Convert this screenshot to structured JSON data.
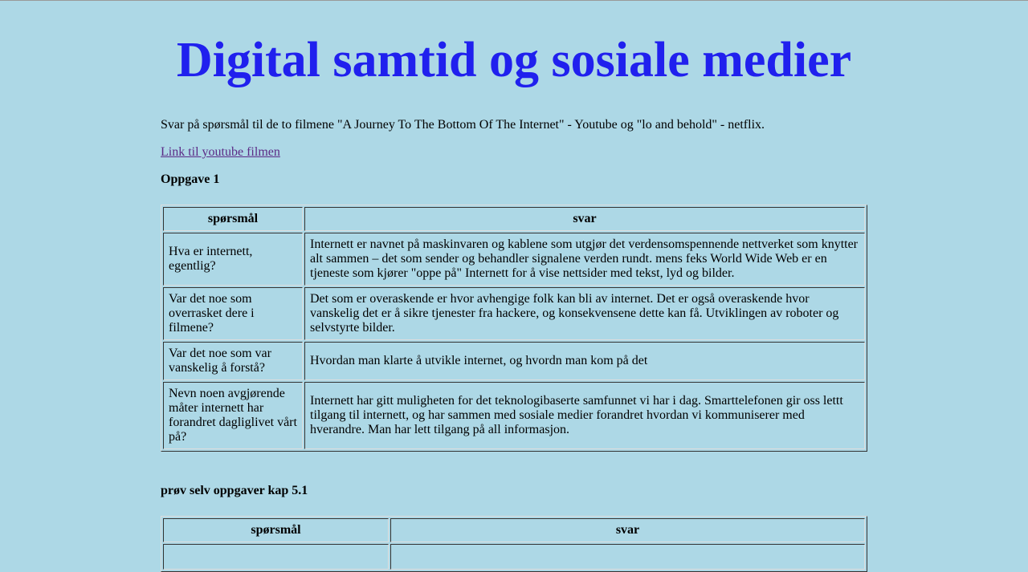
{
  "title": "Digital samtid og sosiale medier",
  "intro": "Svar på spørsmål til de to filmene \"A Journey To The Bottom Of The Internet\" - Youtube og \"lo and behold\" - netflix.",
  "link_label": "Link til youtube filmen",
  "section1": {
    "heading": "Oppgave 1",
    "headers": [
      "spørsmål",
      "svar"
    ],
    "rows": [
      {
        "q": "Hva er internett, egentlig?",
        "a": "Internett er navnet på maskinvaren og kablene som utgjør det verdensomspennende nettverket som knytter alt sammen – det som sender og behandler signalene verden rundt.  mens feks World Wide Web er en tjeneste som kjører \"oppe på\" Internett for å vise nettsider med tekst, lyd og bilder."
      },
      {
        "q": "Var det noe som overrasket dere i filmene?",
        "a": "Det som er overaskende er hvor avhengige folk kan bli av internet. Det er også overaskende hvor vanskelig det er å sikre tjenester fra hackere, og konsekvensene dette kan få. Utviklingen av roboter og selvstyrte bilder."
      },
      {
        "q": "Var det noe som var vanskelig å forstå?",
        "a": "Hvordan man klarte å utvikle internet, og hvordn man kom på det"
      },
      {
        "q": "Nevn noen avgjørende måter internett har forandret dagliglivet vårt på?",
        "a": "Internett har gitt muligheten for det teknologibaserte samfunnet vi har i dag. Smarttelefonen gir oss lettt tilgang til internett, og har sammen med sosiale medier forandret hvordan vi kommuniserer med hverandre. Man har lett tilgang på all informasjon."
      }
    ]
  },
  "section2": {
    "heading": "prøv selv oppgaver kap 5.1",
    "headers": [
      "spørsmål",
      "svar"
    ]
  }
}
